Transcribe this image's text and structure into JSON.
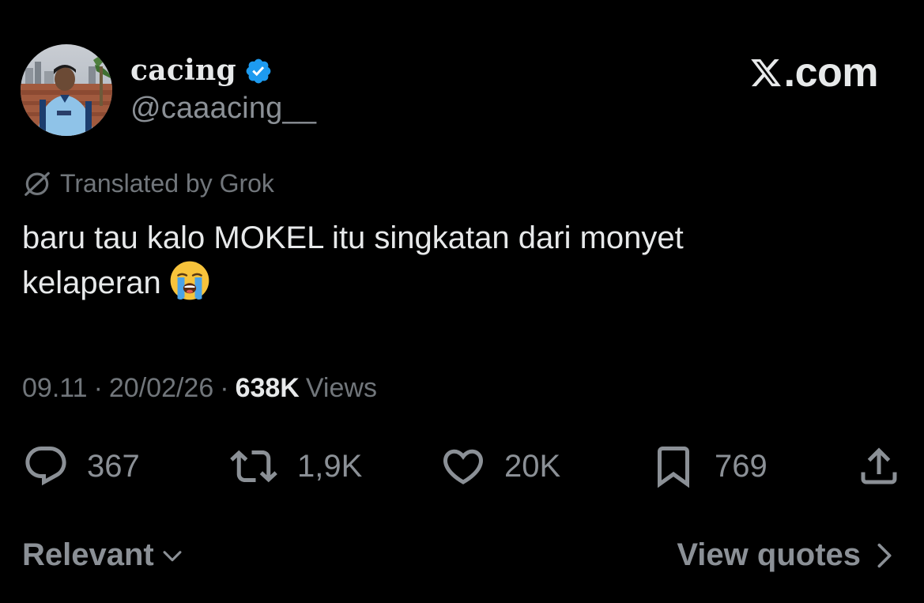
{
  "author": {
    "display_name": "cacing",
    "handle": "@caaacing__",
    "verified": true,
    "avatar_icon": "avatar-photo"
  },
  "brand": {
    "label": ".com",
    "icon": "x-logo-icon"
  },
  "translation": {
    "label": "Translated by Grok",
    "icon": "grok-icon"
  },
  "tweet": {
    "line1": "baru tau kalo MOKEL itu singkatan dari monyet",
    "line2": "kelaperan",
    "emoji": "loudly-crying-face-emoji"
  },
  "meta": {
    "time": "09.11",
    "sep1": "·",
    "date": "20/02/26",
    "sep2": "·",
    "views_count": "638K",
    "views_label": "Views"
  },
  "actions": {
    "replies": "367",
    "reposts": "1,9K",
    "likes": "20K",
    "bookmarks": "769"
  },
  "footer": {
    "sort_label": "Relevant",
    "quotes_label": "View quotes"
  },
  "colors": {
    "background": "#000000",
    "text_primary": "#e7e9ea",
    "text_secondary": "#71767b",
    "verified_blue": "#1d9bf0"
  }
}
